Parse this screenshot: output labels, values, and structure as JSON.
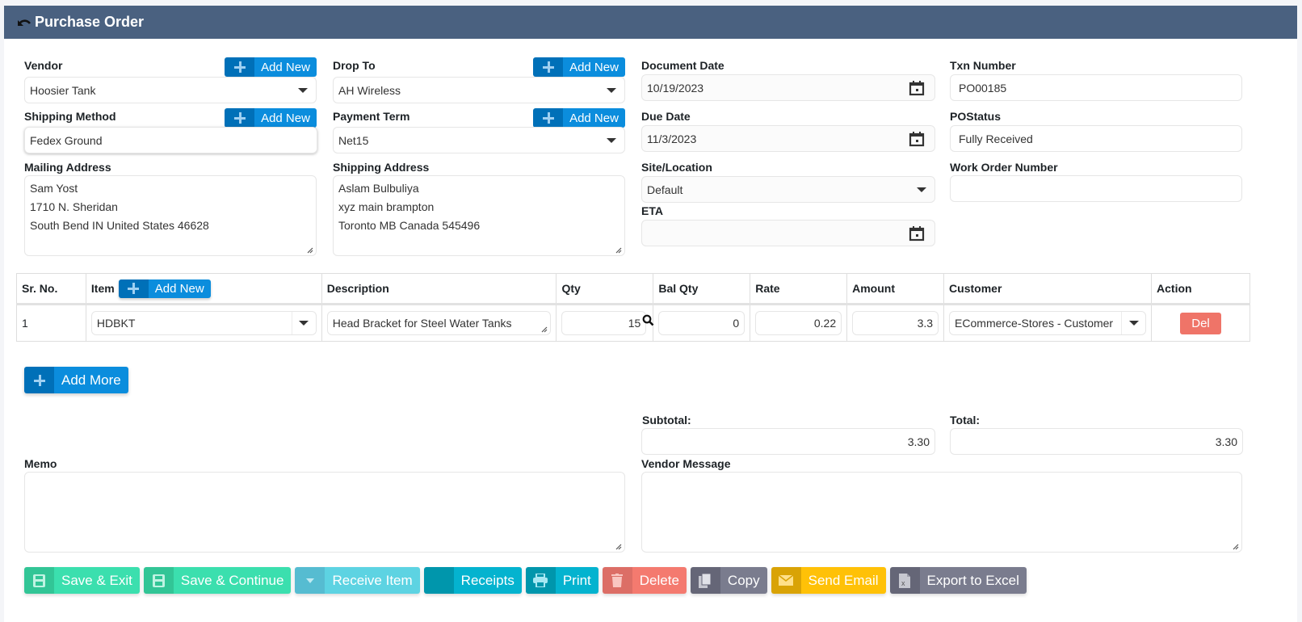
{
  "header": {
    "title": "Purchase Order",
    "back_icon": "undo-arrow-icon"
  },
  "form": {
    "vendor": {
      "label": "Vendor",
      "value": "Hoosier Tank",
      "add_new": "Add New"
    },
    "drop_to": {
      "label": "Drop To",
      "value": "AH Wireless",
      "add_new": "Add New"
    },
    "document_date": {
      "label": "Document Date",
      "value": "10/19/2023"
    },
    "txn_number": {
      "label": "Txn Number",
      "value": "PO00185"
    },
    "shipping_method": {
      "label": "Shipping Method",
      "value": "Fedex Ground",
      "add_new": "Add New"
    },
    "payment_term": {
      "label": "Payment Term",
      "value": "Net15",
      "add_new": "Add New"
    },
    "due_date": {
      "label": "Due Date",
      "value": "11/3/2023"
    },
    "po_status": {
      "label": "POStatus",
      "value": "Fully Received"
    },
    "mailing_address": {
      "label": "Mailing Address",
      "lines": [
        "Sam Yost",
        "1710 N. Sheridan",
        "South Bend IN United States 46628"
      ]
    },
    "shipping_address": {
      "label": "Shipping Address",
      "lines": [
        "Aslam Bulbuliya",
        "xyz main brampton",
        "Toronto MB Canada 545496"
      ]
    },
    "site_location": {
      "label": "Site/Location",
      "value": "Default"
    },
    "eta": {
      "label": "ETA",
      "value": ""
    },
    "work_order_number": {
      "label": "Work Order Number",
      "value": ""
    }
  },
  "items_table": {
    "columns": [
      "Sr. No.",
      "Item",
      "Description",
      "Qty",
      "Bal Qty",
      "Rate",
      "Amount",
      "Customer",
      "Action"
    ],
    "item_add_new": "Add New",
    "rows": [
      {
        "sr_no": "1",
        "item": "HDBKT",
        "description": "Head Bracket for Steel Water Tanks",
        "qty": "15",
        "bal_qty": "0",
        "rate": "0.22",
        "amount": "3.3",
        "customer": "ECommerce-Stores - Customer",
        "action": "Del"
      }
    ],
    "add_more": "Add More"
  },
  "totals": {
    "subtotal_label": "Subtotal:",
    "subtotal": "3.30",
    "total_label": "Total:",
    "total": "3.30"
  },
  "memo": {
    "label": "Memo",
    "value": ""
  },
  "vendor_message": {
    "label": "Vendor Message",
    "value": ""
  },
  "actions": [
    {
      "label": "Save & Exit",
      "icon": "floppy-disk-icon",
      "color": "#3bdfae",
      "icon_bg": "#32c596"
    },
    {
      "label": "Save & Continue",
      "icon": "floppy-disk-icon",
      "color": "#3bdfae",
      "icon_bg": "#32c596"
    },
    {
      "label": "Receive Item",
      "icon": "caret-down-icon",
      "color": "#5dd3e2",
      "icon_bg": "#56bcd1"
    },
    {
      "label": "Receipts",
      "icon": "receipt-icon",
      "color": "#04b3cf",
      "icon_bg": "#0096ac"
    },
    {
      "label": "Print",
      "icon": "printer-icon",
      "color": "#04b3cf",
      "icon_bg": "#0096ac"
    },
    {
      "label": "Delete",
      "icon": "trash-icon",
      "color": "#f47a6f",
      "icon_bg": "#dc6e66"
    },
    {
      "label": "Copy",
      "icon": "copy-icon",
      "color": "#7a7c8e",
      "icon_bg": "#656677"
    },
    {
      "label": "Send Email",
      "icon": "envelope-icon",
      "color": "#ffc107",
      "icon_bg": "#d9a306"
    },
    {
      "label": "Export to Excel",
      "icon": "excel-file-icon",
      "color": "#7a7c8e",
      "icon_bg": "#656677"
    }
  ]
}
